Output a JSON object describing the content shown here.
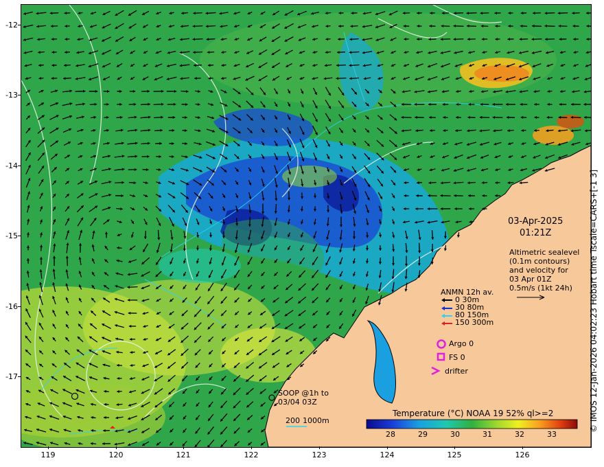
{
  "map": {
    "lat_ticks": [
      "-12",
      "-13",
      "-14",
      "-15",
      "-16",
      "-17"
    ],
    "lon_ticks": [
      "119",
      "120",
      "121",
      "122",
      "123",
      "124",
      "125",
      "126"
    ],
    "lon_range": [
      118.6,
      127.0
    ],
    "lat_range": [
      -11.7,
      -17.97
    ]
  },
  "timestamp": {
    "date": "03-Apr-2025",
    "time": "01:21Z"
  },
  "altimetry_note": [
    "Altimetric sealevel",
    "(0.1m contours)",
    "and velocity for",
    "03 Apr 01Z",
    "0.5m/s (1kt 24h)"
  ],
  "legend": {
    "title": "ANMN 12h av.",
    "items": [
      {
        "label": "0 30m",
        "color": "#000000"
      },
      {
        "label": "30 80m",
        "color": "#1030d0"
      },
      {
        "label": "80 150m",
        "color": "#30d0f0"
      },
      {
        "label": "150 300m",
        "color": "#e02020"
      }
    ],
    "argo": "Argo 0",
    "fs": "FS 0",
    "drifter": "drifter",
    "marker_color": "#e020e0"
  },
  "soop": {
    "line1": "SOOP @1h to",
    "line2": "03/04 03Z"
  },
  "bathy": {
    "label1": "200",
    "label2": "1000m",
    "color": "#30d0f0"
  },
  "colorbar": {
    "title": "Temperature (°C) NOAA 19 52% ql>=2",
    "ticks": [
      "28",
      "29",
      "30",
      "31",
      "32",
      "33"
    ],
    "range": [
      27.3,
      33.8
    ]
  },
  "credit": "© IMOS 12-Jan-2026 04:02:23 Hobart time Tscale=CARS+[-1 3]"
}
